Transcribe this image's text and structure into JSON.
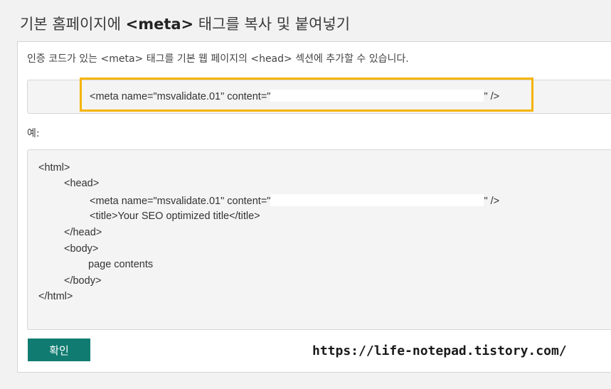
{
  "header": {
    "title_prefix": "기본 홈페이지에 ",
    "title_tag": "<meta>",
    "title_suffix": " 태그를 복사 및 붙여넣기"
  },
  "panel": {
    "description": "인증 코드가 있는 <meta> 태그를 기본 웹 페이지의 <head> 섹션에 추가할 수 있습니다.",
    "meta_tag_start": "<meta name=\"msvalidate.01\" content=\"",
    "meta_tag_end": "\" />",
    "example_label": "예:",
    "example_code": {
      "html_open": "<html>",
      "head_open": "<head>",
      "meta_start": "<meta name=\"msvalidate.01\" content=\"",
      "meta_end": "\" />",
      "title_line": "<title>Your SEO optimized title</title>",
      "head_close": "</head>",
      "body_open": "<body>",
      "page_contents": "page contents",
      "body_close": "</body>",
      "html_close": "</html>"
    },
    "confirm_button": "확인"
  },
  "watermark": "https://life-notepad.tistory.com/",
  "colors": {
    "accent": "#107c71",
    "highlight": "#f5b400",
    "code_bg": "#f4f4f4"
  }
}
